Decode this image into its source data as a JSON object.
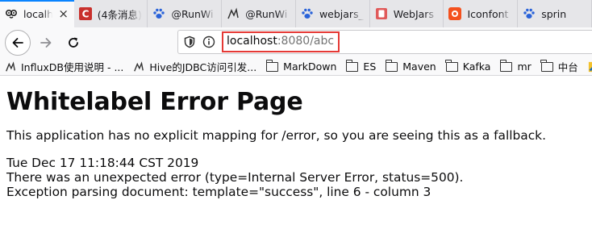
{
  "tabs": [
    {
      "title": "localh",
      "active": true,
      "icon": "owl-icon",
      "close": "×"
    },
    {
      "title": "(4条消息)",
      "active": false,
      "icon": "csdn-icon"
    },
    {
      "title": "@RunWi",
      "active": false,
      "icon": "paw-icon"
    },
    {
      "title": "@RunWi",
      "active": false,
      "icon": "feather-icon"
    },
    {
      "title": "webjars_",
      "active": false,
      "icon": "paw-icon"
    },
    {
      "title": "WebJars",
      "active": false,
      "icon": "webjars-icon"
    },
    {
      "title": "Iconfont",
      "active": false,
      "icon": "iconfont-icon"
    },
    {
      "title": "sprin",
      "active": false,
      "icon": "paw-icon"
    }
  ],
  "url": {
    "host": "localhost",
    "rest": ":8080/abc"
  },
  "bookmarks": [
    {
      "label": "InfluxDB使用说明 - ...",
      "icon": "feather-icon"
    },
    {
      "label": "Hive的JDBC访问引发...",
      "icon": "feather-icon"
    },
    {
      "label": "MarkDown",
      "icon": "folder-icon"
    },
    {
      "label": "ES",
      "icon": "folder-icon"
    },
    {
      "label": "Maven",
      "icon": "folder-icon"
    },
    {
      "label": "Kafka",
      "icon": "folder-icon"
    },
    {
      "label": "mr",
      "icon": "folder-icon"
    },
    {
      "label": "中台",
      "icon": "folder-icon"
    }
  ],
  "page": {
    "title": "Whitelabel Error Page",
    "description": "This application has no explicit mapping for /error, so you are seeing this as a fallback.",
    "timestamp": "Tue Dec 17 11:18:44 CST 2019",
    "error_line": "There was an unexpected error (type=Internal Server Error, status=500).",
    "exception_line": "Exception parsing document: template=\"success\", line 6 - column 3"
  },
  "colors": {
    "accent": "#0a84ff",
    "highlight_border": "#e53935",
    "csdn": "#c9302c",
    "paw": "#2a63d9",
    "webjars": "#e05a5a",
    "iconfont": "#f4511e"
  }
}
